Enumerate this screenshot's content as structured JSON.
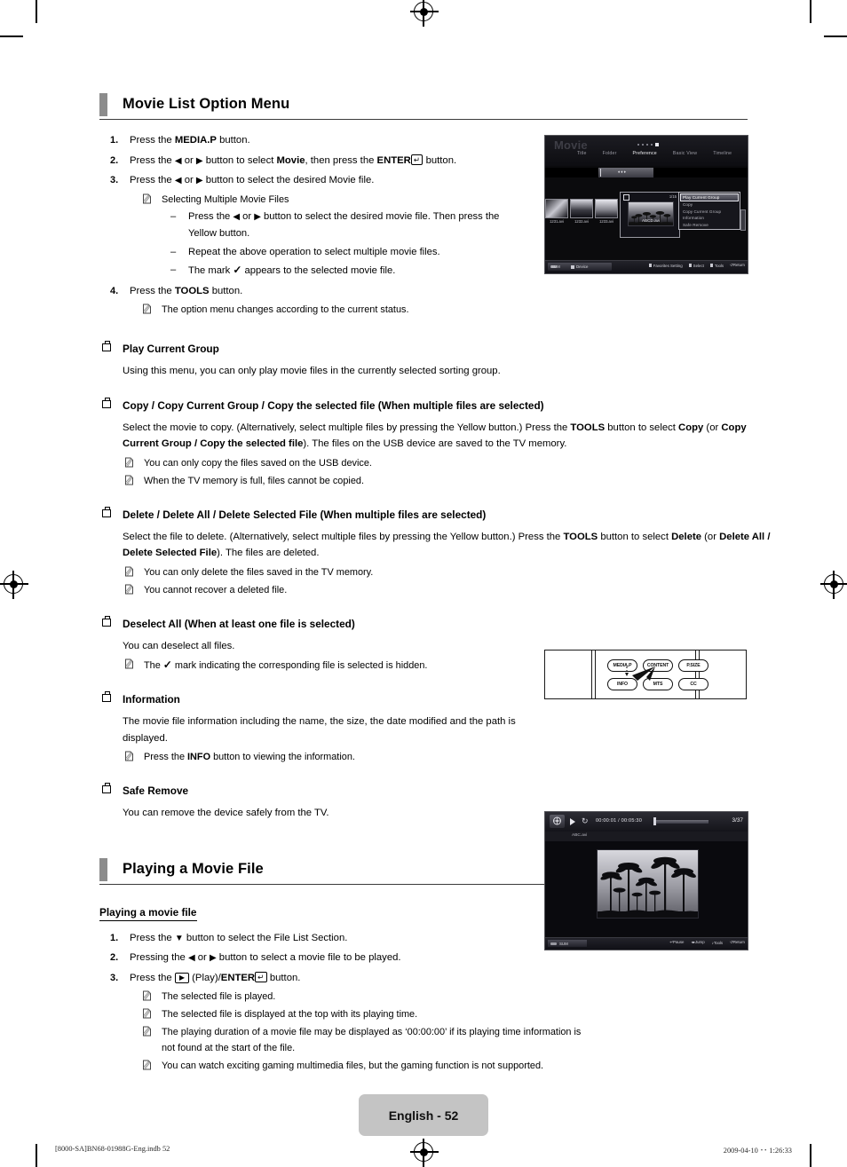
{
  "page": {
    "footer_page_label": "English - 52",
    "footer_left": "[8000-SA]BN68-01988G-Eng.indb   52",
    "footer_right": "2009-04-10   ･･ 1:26:33"
  },
  "section1": {
    "title": "Movie List Option Menu",
    "steps": [
      {
        "num": "1.",
        "html": "Press the <b>MEDIA.P</b> button."
      },
      {
        "num": "2.",
        "html": "Press the <span class=\"arrow\">◀</span> or <span class=\"arrow\">▶</span> button to select <b>Movie</b>, then press the <b>ENTER</b><span class=\"key-enter\">↵</span> button."
      },
      {
        "num": "3.",
        "html": "Press the <span class=\"arrow\">◀</span> or <span class=\"arrow\">▶</span> button to select the desired Movie file."
      },
      {
        "num": "4.",
        "html": "Press the <b>TOOLS</b> button."
      }
    ],
    "note_step3": "Selecting Multiple Movie Files",
    "dashes": [
      "Press the <span class=\"arrow\">◀</span> or <span class=\"arrow\">▶</span> button to select the desired movie file. Then press the Yellow button.",
      "Repeat the above operation to select multiple movie files.",
      "The mark <span class=\"chk\">✓</span> appears to the selected movie file."
    ],
    "note_step4": "The option menu changes according to the current status."
  },
  "options": [
    {
      "heading": "Play Current Group",
      "body_html": "Using this menu, you can only play movie files in the currently selected sorting group.",
      "notes": []
    },
    {
      "heading": "Copy / Copy Current Group / Copy the selected file (When multiple files are selected)",
      "body_html": "Select the movie to copy. (Alternatively, select multiple files by pressing the Yellow button.) Press the <b>TOOLS</b> button to select <b>Copy</b> (or <b>Copy Current Group / Copy the selected file</b>). The files on the USB device are saved to the TV memory.",
      "notes": [
        "You can only copy the files saved on the USB device.",
        "When the TV memory is full, files cannot be copied."
      ]
    },
    {
      "heading": "Delete / Delete All / Delete Selected File (When multiple files are selected)",
      "body_html": "Select the file to delete. (Alternatively, select multiple files by pressing the Yellow button.) Press the <b>TOOLS</b> button to select <b>Delete</b> (or <b>Delete All / Delete Selected File</b>). The files are deleted.",
      "notes": [
        "You can only delete the files saved in the TV memory.",
        "You cannot recover a deleted file."
      ]
    },
    {
      "heading": "Deselect All (When at least one file is selected)",
      "body_html": "You can deselect all files.",
      "notes": [
        "The <span class=\"chk\">✓</span> mark indicating the corresponding file is selected is hidden."
      ]
    },
    {
      "heading": "Information",
      "body_html": "The movie file information including the name, the size, the date modified and the path is displayed.",
      "notes": [
        "Press the <b>INFO</b> button to viewing the information."
      ]
    },
    {
      "heading": "Safe Remove",
      "body_html": "You can remove the device safely from the TV.",
      "notes": []
    }
  ],
  "section2": {
    "title": "Playing a Movie File",
    "sub_heading": "Playing a movie file",
    "steps": [
      {
        "num": "1.",
        "html": "Press the <span class=\"arrow\">▼</span> button to select the File List Section."
      },
      {
        "num": "2.",
        "html": "Pressing the <span class=\"arrow\">◀</span> or <span class=\"arrow\">▶</span> button to select a movie file to be played."
      },
      {
        "num": "3.",
        "html": "Press the <span class=\"key-play\">▶</span> (Play)/<b>ENTER</b><span class=\"key-enter\">↵</span> button."
      }
    ],
    "notes": [
      "The selected file is played.",
      "The selected file is displayed at the top with its playing time.",
      "The playing duration of a movie file may be displayed as ‘00:00:00’ if its playing time information is not found at the start of the file.",
      "You can watch exciting gaming multimedia files, but the gaming function is not supported."
    ]
  },
  "movie_list_shot": {
    "title": "Movie",
    "tabs": [
      "Title",
      "Folder",
      "Preference",
      "Basic View",
      "Timeline"
    ],
    "selected_tab": "Preference",
    "sort_chip_label": "♦♦♦",
    "thumbnails": [
      {
        "label": "1231.avi"
      },
      {
        "label": "1232.avi"
      },
      {
        "label": "1233.avi"
      }
    ],
    "selected_file": "ABCD.avi",
    "selection_count": "1/15",
    "context_menu": [
      "Play Current Group",
      "Copy",
      "Copy Current Group",
      "Information",
      "Safe Remove"
    ],
    "context_menu_selected": "Play Current Group",
    "footer_left": [
      "SUM",
      "Device"
    ],
    "footer_right": [
      "Favorites Setting",
      "Select",
      "Tools",
      "Return"
    ]
  },
  "remote": {
    "buttons_top": [
      "MEDIA.P",
      "CONTENT",
      "P.SIZE"
    ],
    "buttons_bottom": [
      "INFO",
      "MTS",
      "CC"
    ]
  },
  "movie_play_shot": {
    "time": "00:00:01 / 00:05:30",
    "counter": "3/37",
    "file_name": "ABC.avi",
    "footer_left": "SUM",
    "footer_right": [
      "Pause",
      "Jump",
      "Tools",
      "Return"
    ]
  },
  "colors": {
    "heading_accent": "#8c8c8c",
    "page_pill": "#c4c4c4",
    "rule": "#3a3a3a"
  }
}
